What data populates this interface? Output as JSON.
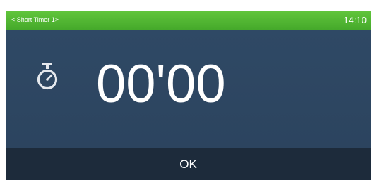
{
  "header": {
    "title": "< Short Timer 1>",
    "time": "14:10",
    "color": "#52b834"
  },
  "timer": {
    "icon": "stopwatch-icon",
    "value": "00'00"
  },
  "footer": {
    "ok_label": "OK"
  },
  "colors": {
    "background": "#2e4763",
    "footer": "#1d2b3b",
    "text": "#ffffff"
  }
}
